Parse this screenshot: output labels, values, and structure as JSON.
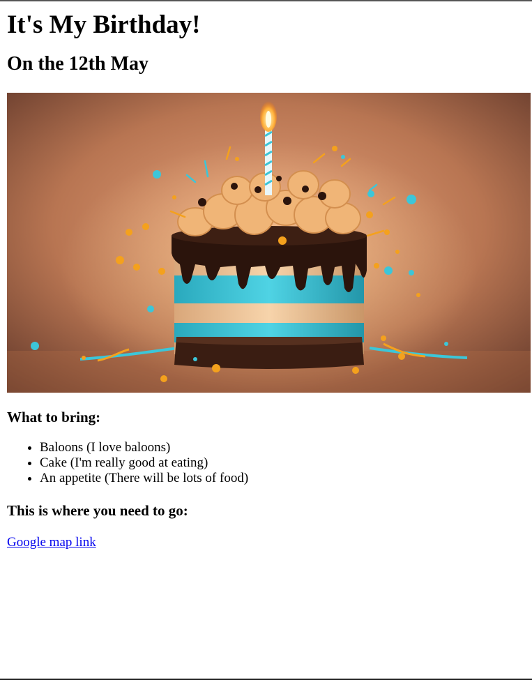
{
  "page": {
    "title": "It's My Birthday!",
    "date_heading": "On the 12th May"
  },
  "hero_image": {
    "icon": "birthday-cake-image",
    "colors": {
      "background": "#a8653e",
      "frosting_blue": "#3cc6d8",
      "cream": "#f3c79a",
      "chocolate": "#3a1d12",
      "sprinkle_orange": "#f4a11d"
    }
  },
  "bring": {
    "heading": "What to bring:",
    "items": [
      "Baloons (I love baloons)",
      "Cake (I'm really good at eating)",
      "An appetite (There will be lots of food)"
    ]
  },
  "location": {
    "heading": "This is where you need to go:",
    "link_text": "Google map link",
    "link_color": "#0000ee"
  }
}
